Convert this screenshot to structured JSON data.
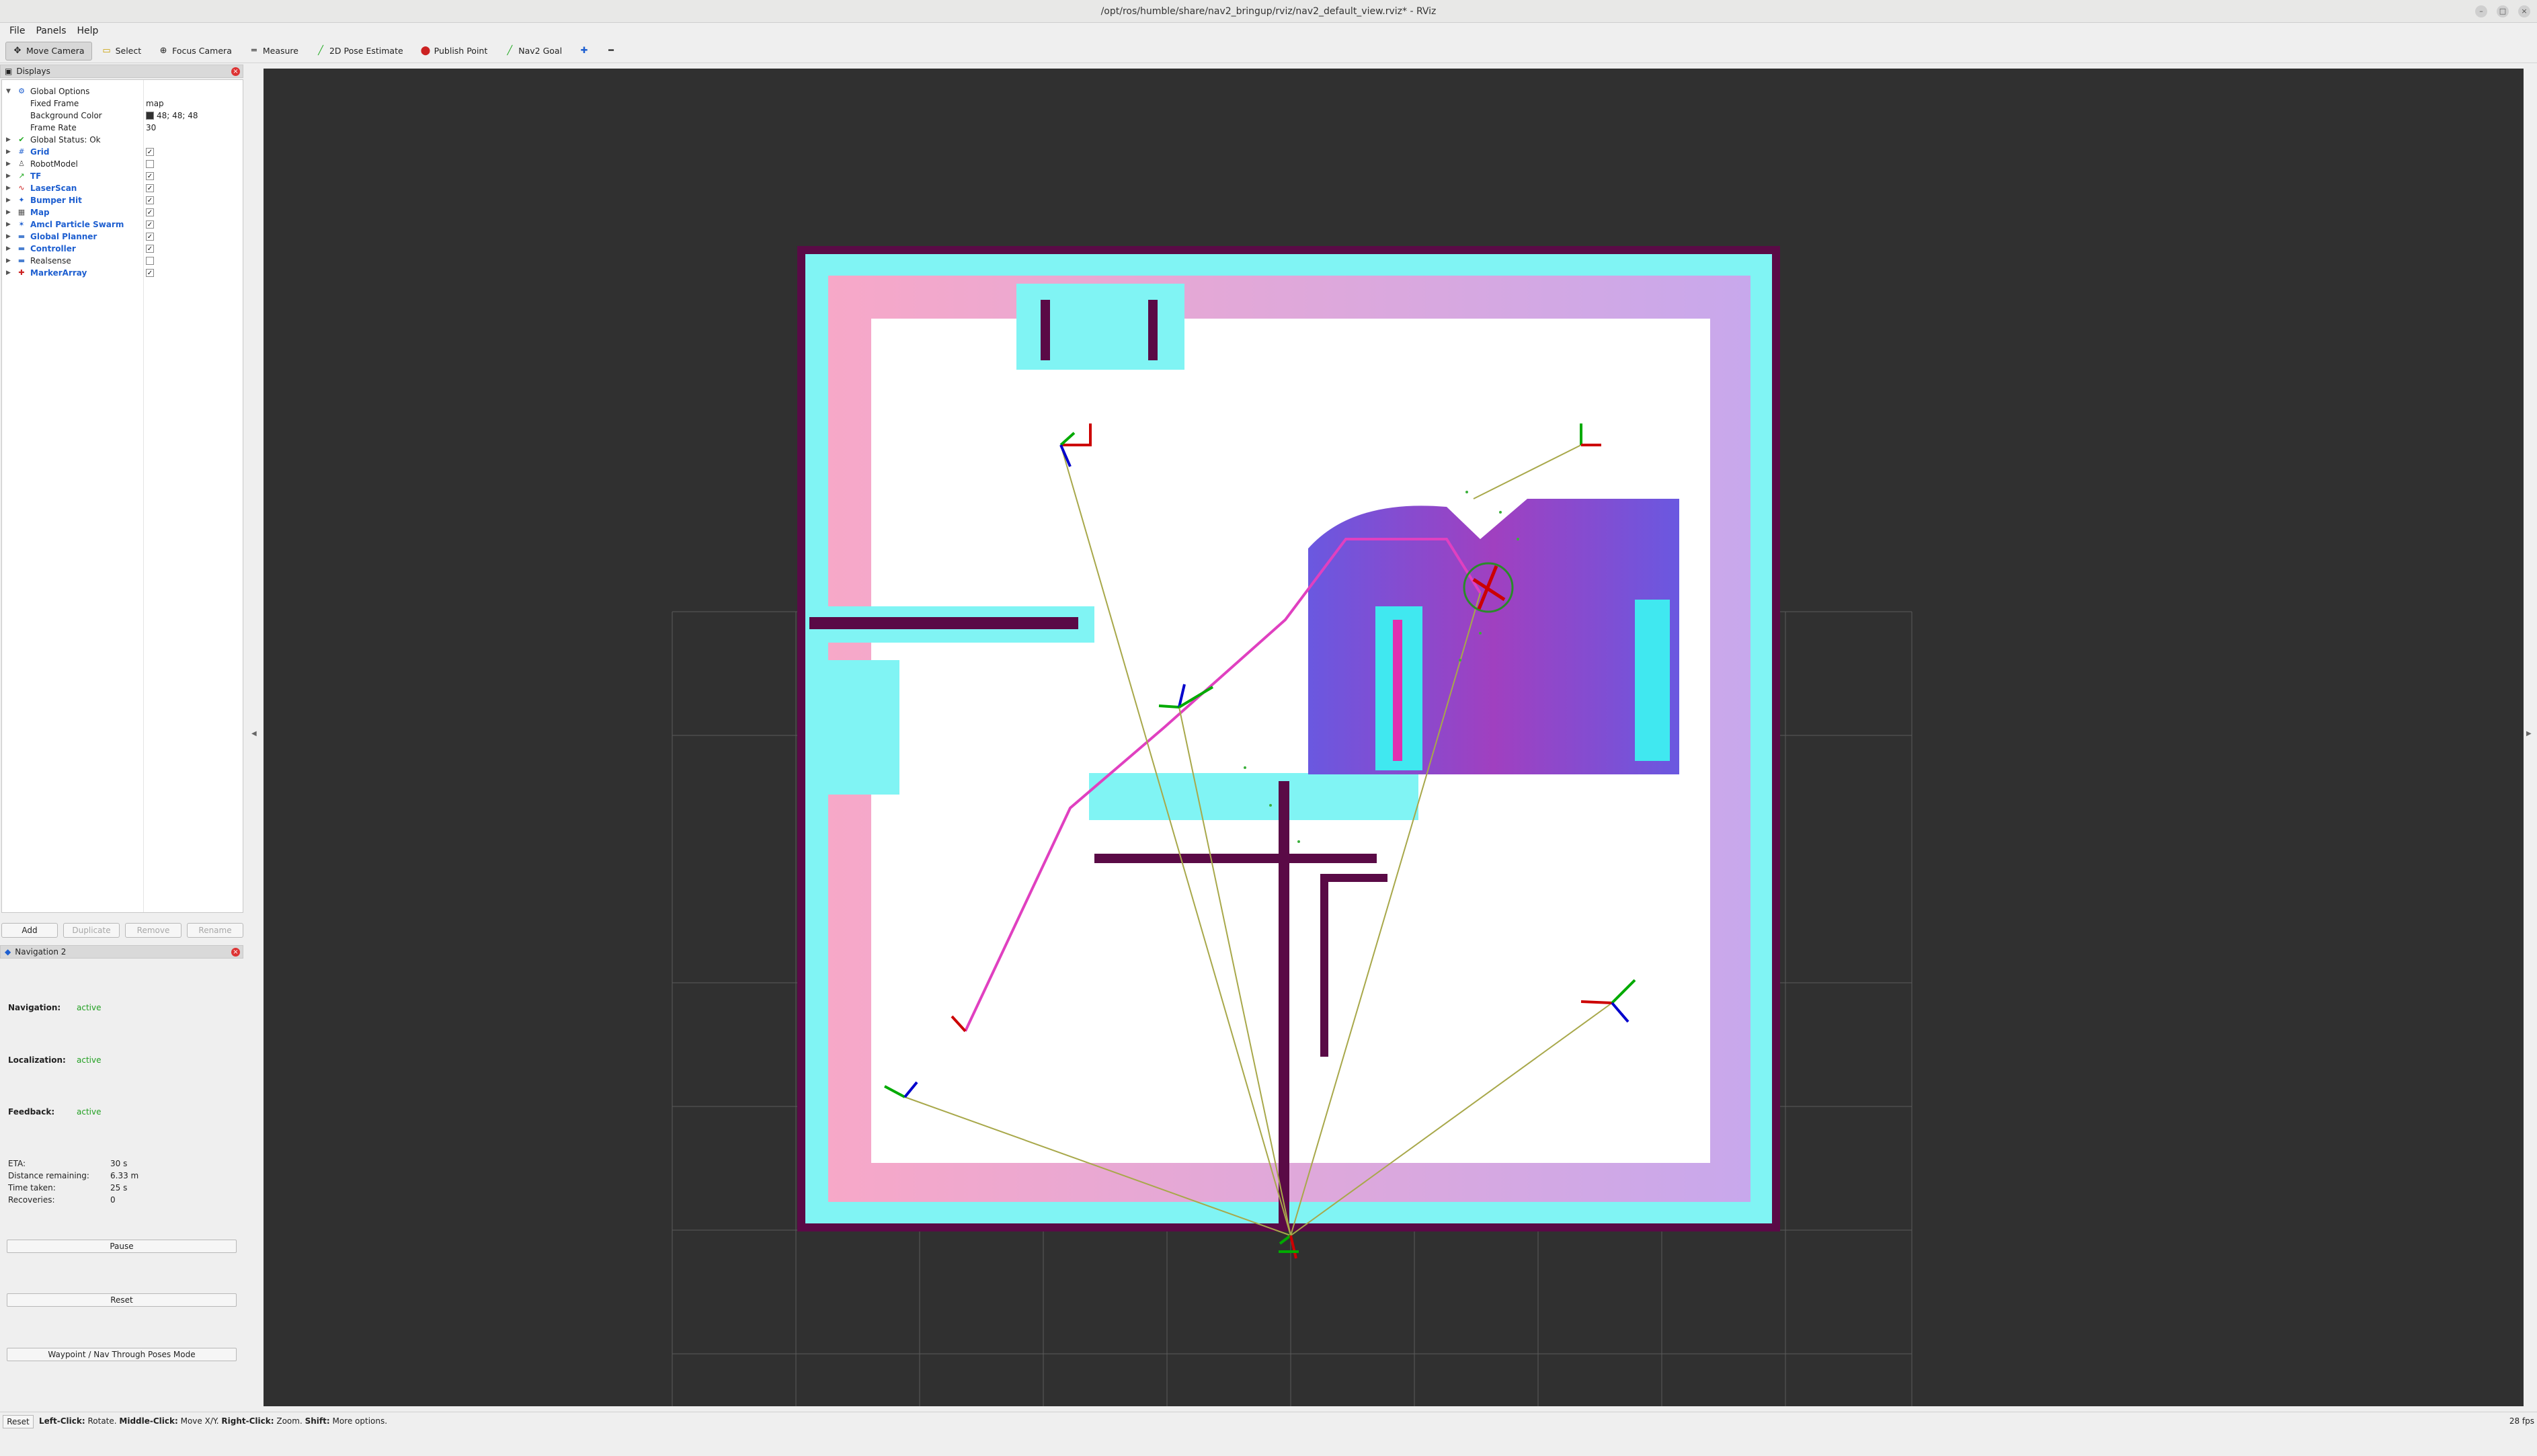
{
  "window": {
    "title": "/opt/ros/humble/share/nav2_bringup/rviz/nav2_default_view.rviz* - RViz"
  },
  "menu": [
    "File",
    "Panels",
    "Help"
  ],
  "toolbar": [
    {
      "label": "Move Camera",
      "icon": "move-camera-icon",
      "active": true
    },
    {
      "label": "Select",
      "icon": "select-icon",
      "active": false
    },
    {
      "label": "Focus Camera",
      "icon": "focus-camera-icon",
      "active": false
    },
    {
      "label": "Measure",
      "icon": "measure-icon",
      "active": false
    },
    {
      "label": "2D Pose Estimate",
      "icon": "pose-estimate-icon",
      "active": false
    },
    {
      "label": "Publish Point",
      "icon": "publish-point-icon",
      "active": false
    },
    {
      "label": "Nav2 Goal",
      "icon": "nav2-goal-icon",
      "active": false
    }
  ],
  "displays": {
    "title": "Displays",
    "global_options": "Global Options",
    "fixed_frame_label": "Fixed Frame",
    "fixed_frame_value": "map",
    "background_color_label": "Background Color",
    "background_color_value": "48; 48; 48",
    "frame_rate_label": "Frame Rate",
    "frame_rate_value": "30",
    "global_status": "Global Status: Ok",
    "items": [
      {
        "label": "Grid",
        "checked": true,
        "highlight": true
      },
      {
        "label": "RobotModel",
        "checked": false,
        "highlight": false
      },
      {
        "label": "TF",
        "checked": true,
        "highlight": true
      },
      {
        "label": "LaserScan",
        "checked": true,
        "highlight": true
      },
      {
        "label": "Bumper Hit",
        "checked": true,
        "highlight": true
      },
      {
        "label": "Map",
        "checked": true,
        "highlight": true
      },
      {
        "label": "Amcl Particle Swarm",
        "checked": true,
        "highlight": true
      },
      {
        "label": "Global Planner",
        "checked": true,
        "highlight": true
      },
      {
        "label": "Controller",
        "checked": true,
        "highlight": true
      },
      {
        "label": "Realsense",
        "checked": false,
        "highlight": false
      },
      {
        "label": "MarkerArray",
        "checked": true,
        "highlight": true
      }
    ],
    "buttons": {
      "add": "Add",
      "duplicate": "Duplicate",
      "remove": "Remove",
      "rename": "Rename"
    }
  },
  "navigation": {
    "title": "Navigation 2",
    "navigation_label": "Navigation:",
    "navigation_value": "active",
    "localization_label": "Localization:",
    "localization_value": "active",
    "feedback_label": "Feedback:",
    "feedback_value": "active",
    "eta_label": "ETA:",
    "eta_value": "30 s",
    "distance_label": "Distance remaining:",
    "distance_value": "6.33 m",
    "time_label": "Time taken:",
    "time_value": "25 s",
    "recoveries_label": "Recoveries:",
    "recoveries_value": "0",
    "pause": "Pause",
    "reset": "Reset",
    "waypoint": "Waypoint / Nav Through Poses Mode"
  },
  "status": {
    "reset": "Reset",
    "hint_left_bold": "Left-Click:",
    "hint_left": " Rotate. ",
    "hint_middle_bold": "Middle-Click:",
    "hint_middle": " Move X/Y. ",
    "hint_right_bold": "Right-Click:",
    "hint_right": " Zoom. ",
    "hint_shift_bold": "Shift:",
    "hint_shift": " More options.",
    "fps": "28 fps"
  },
  "colors": {
    "viewport_bg": "#303030",
    "path": "#e040c0",
    "active": "#22a022",
    "highlight": "#1e5fd0"
  }
}
